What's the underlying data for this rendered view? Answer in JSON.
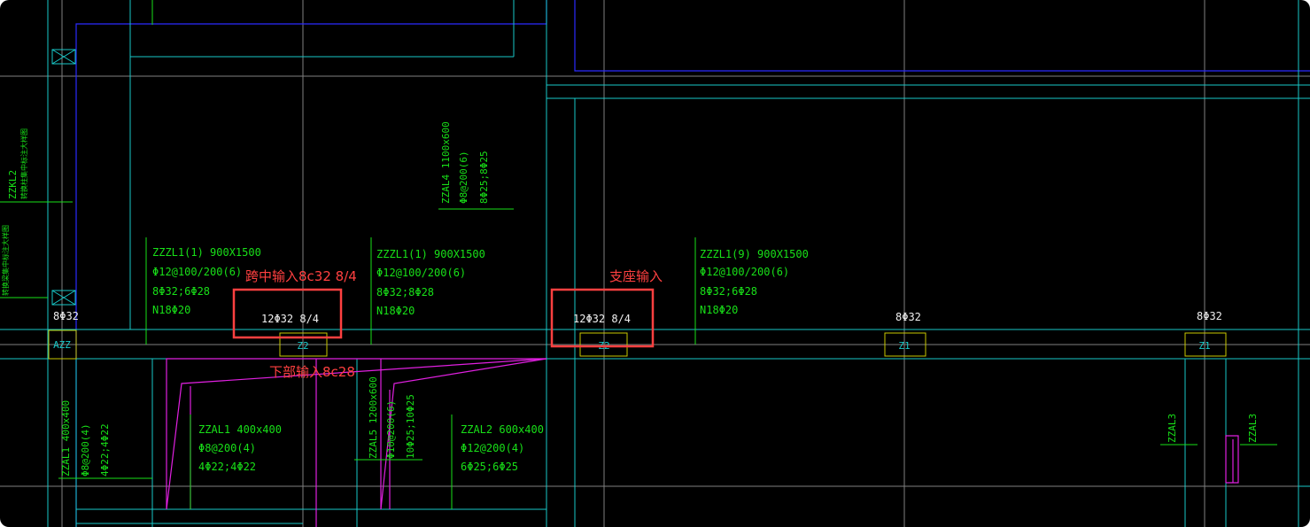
{
  "colors": {
    "background": "#000000",
    "grid": "#7f7f7f",
    "axis_blue": "#2a2aff",
    "cyan": "#18c8c8",
    "green_text": "#18e018",
    "white_text": "#f0f0f0",
    "yellow_box": "#c8c800",
    "magenta": "#e020e0",
    "annotation_red": "#ff4040"
  },
  "beam_labels": [
    {
      "name": "ZZZL1(1) 900X1500",
      "stirrup": "Φ12@100/200(6)",
      "top_bottom": "8Φ32;6Φ28",
      "side": "N18Φ20"
    },
    {
      "name": "ZZZL1(1) 900X1500",
      "stirrup": "Φ12@100/200(6)",
      "top_bottom": "8Φ32;8Φ28",
      "side": "N18Φ20"
    },
    {
      "name": "ZZZL1(9) 900X1500",
      "stirrup": "Φ12@100/200(6)",
      "top_bottom": "8Φ32;6Φ28",
      "side": "N18Φ20"
    }
  ],
  "support_rebar": {
    "left": "8Φ32",
    "midspan": "12Φ32 8/4",
    "support": "12Φ32 8/4",
    "right1": "8Φ32",
    "right2": "8Φ32"
  },
  "column_tags": {
    "azz": "AZZ",
    "z2_left": "Z2",
    "z2_right": "Z2",
    "z1_a": "Z1",
    "z1_b": "Z1"
  },
  "vertical_labels": {
    "zzal4_name": "ZZAL4 1100x600",
    "zzal4_stirrup": "Φ8@200(6)",
    "zzal4_bars": "8Φ25;8Φ25",
    "zzkl_left_1": "ZZKL2",
    "zzkl_left_2": "转换柱集中标注大样图",
    "zzkl_left_3": "转换梁集中标注大样图",
    "zzal1_name": "ZZAL1 400x400",
    "zzal1_stirrup": "Φ8@200(4)",
    "zzal1_bars": "4Φ22;4Φ22",
    "zzal5_name": "ZZAL5 1200x600",
    "zzal5_stirrup": "Φ10@200(6)",
    "zzal5_bars": "10Φ25;10Φ25",
    "zzal3_a": "ZZAL3",
    "zzal3_b": "ZZAL3"
  },
  "lower_labels": [
    {
      "name": "ZZAL1 400x400",
      "stirrup": "Φ8@200(4)",
      "bars": "4Φ22;4Φ22"
    },
    {
      "name": "ZZAL2 600x400",
      "stirrup": "Φ12@200(4)",
      "bars": "6Φ25;6Φ25"
    }
  ],
  "annotations": {
    "midspan": "跨中输入8c32 8/4",
    "bottom": "下部输入8c28",
    "support": "支座输入"
  }
}
